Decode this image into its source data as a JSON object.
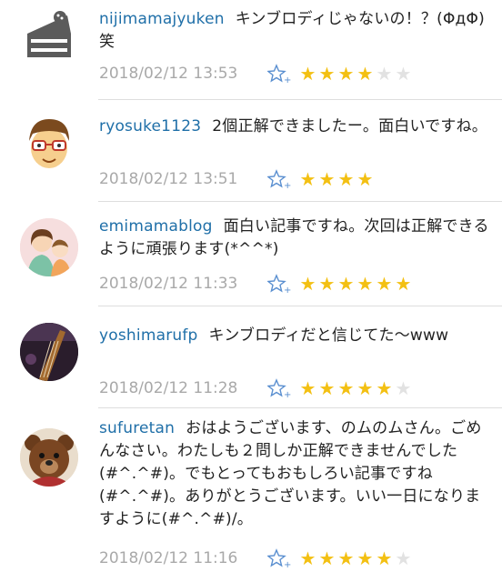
{
  "comments": [
    {
      "username": "nijimamajyuken",
      "text": "キンブロディじゃないの！？(ΦдΦ)笑",
      "date": "2018/02/12 13:53",
      "avatar_icon": "cake-slice-icon",
      "rating": 4,
      "max_rating": 6
    },
    {
      "username": "ryosuke1123",
      "text": "2個正解できましたー。面白いですね。",
      "date": "2018/02/12 13:51",
      "avatar_icon": "glasses-face-icon",
      "rating": 4,
      "max_rating": 4
    },
    {
      "username": "emimamablog",
      "text": "面白い記事ですね。次回は正解できるように頑張ります(*^^*)",
      "date": "2018/02/12 11:33",
      "avatar_icon": "mother-child-illustration-icon",
      "rating": 6,
      "max_rating": 6
    },
    {
      "username": "yoshimarufp",
      "text": "キンブロディだと信じてた〜www",
      "date": "2018/02/12 11:28",
      "avatar_icon": "guitar-photo-icon",
      "rating": 5,
      "max_rating": 6
    },
    {
      "username": "sufuretan",
      "text": "おはようございます、のムのムさん。ごめんなさい。わたしも２問しか正解できませんでした(#^.^#)。でもとってもおもしろい記事ですね(#^.^#)。ありがとうございます。いい一日になりますように(#^.^#)/。",
      "date": "2018/02/12 11:16",
      "avatar_icon": "teddy-bear-icon",
      "rating": 5,
      "max_rating": 6
    }
  ],
  "colors": {
    "username": "#1f6fa8",
    "text": "#222222",
    "date": "#a9a9a9",
    "star_on": "#f3c013",
    "star_off": "#e2e2e2",
    "favorite_icon": "#5a8fd0"
  }
}
